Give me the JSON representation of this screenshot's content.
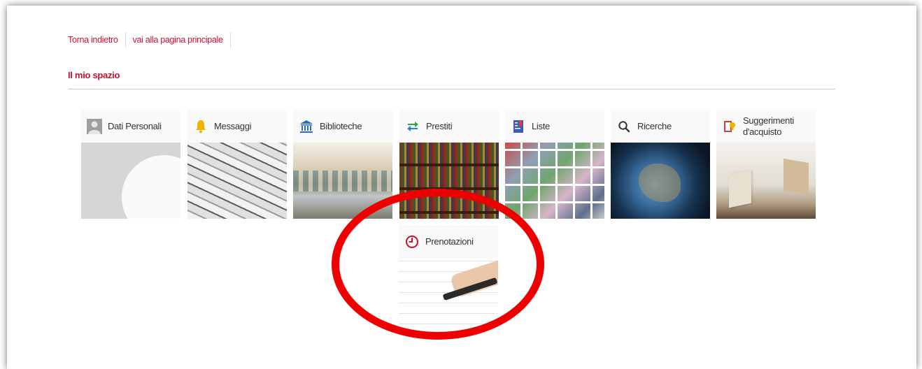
{
  "nav": {
    "back_label": "Torna indietro",
    "home_label": "vai alla pagina principale"
  },
  "section": {
    "title": "Il mio spazio"
  },
  "tiles": [
    {
      "label": "Dati Personali",
      "icon": "user-icon"
    },
    {
      "label": "Messaggi",
      "icon": "bell-icon"
    },
    {
      "label": "Biblioteche",
      "icon": "library-icon"
    },
    {
      "label": "Prestiti",
      "icon": "exchange-arrows-icon"
    },
    {
      "label": "Liste",
      "icon": "bookmark-list-icon"
    },
    {
      "label": "Ricerche",
      "icon": "search-icon"
    },
    {
      "label": "Suggerimenti d'acquisto",
      "icon": "suggestion-icon"
    },
    {
      "label": "Prenotazioni",
      "icon": "clock-icon"
    }
  ],
  "colors": {
    "accent": "#c8102e",
    "highlight": "#ee0000"
  }
}
